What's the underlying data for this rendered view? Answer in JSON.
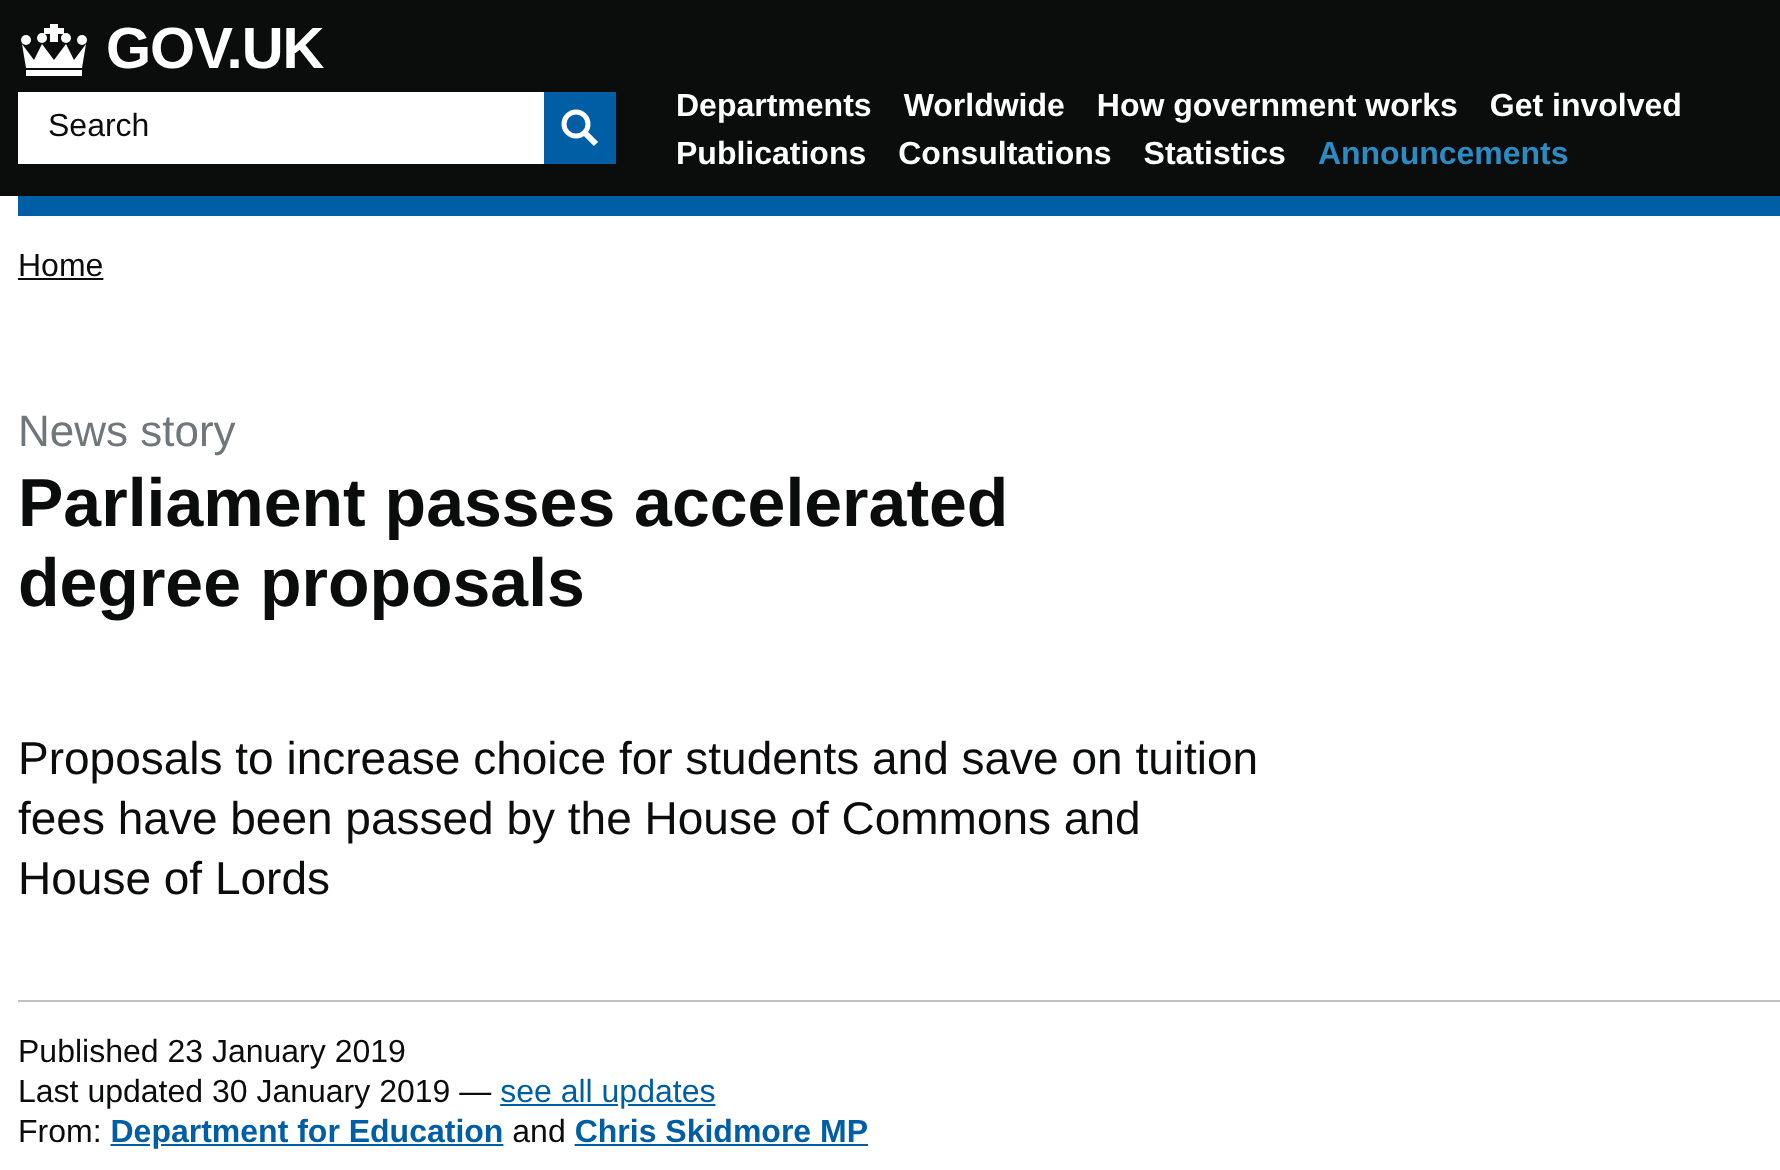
{
  "header": {
    "logo": "GOV.UK",
    "search": {
      "placeholder": "Search"
    },
    "nav": [
      [
        {
          "label": "Departments",
          "selected": false
        },
        {
          "label": "Worldwide",
          "selected": false
        },
        {
          "label": "How government works",
          "selected": false
        },
        {
          "label": "Get involved",
          "selected": false
        }
      ],
      [
        {
          "label": "Publications",
          "selected": false
        },
        {
          "label": "Consultations",
          "selected": false
        },
        {
          "label": "Statistics",
          "selected": false
        },
        {
          "label": "Announcements",
          "selected": true
        }
      ]
    ]
  },
  "breadcrumb": "Home",
  "caption": "News story",
  "title": "Parliament passes accelerated degree proposals",
  "lede": "Proposals to increase choice for students and save on tuition fees have been passed by the House of Commons and House of Lords",
  "metadata": {
    "published": "Published 23 January 2019",
    "updated": "Last updated 30 January 2019 —",
    "updates_link": "see all updates",
    "from_label": "From:",
    "from": [
      {
        "label": "Department for Education"
      },
      {
        "label": "Chris Skidmore MP"
      }
    ],
    "joiner": "and"
  }
}
